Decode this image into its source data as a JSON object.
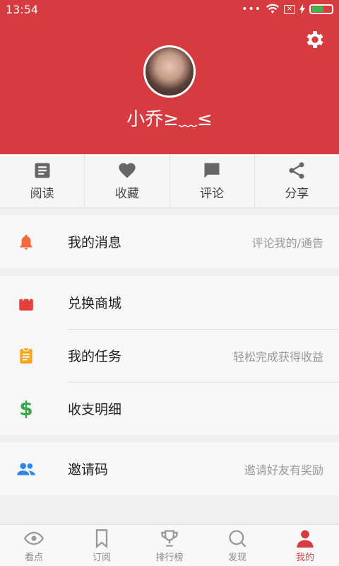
{
  "status": {
    "time": "13:54",
    "battery_level": 0.55
  },
  "profile": {
    "username": "小乔≥﹏≤"
  },
  "actions": [
    {
      "label": "阅读",
      "icon": "read-icon"
    },
    {
      "label": "收藏",
      "icon": "heart-icon"
    },
    {
      "label": "评论",
      "icon": "comment-icon"
    },
    {
      "label": "分享",
      "icon": "share-icon"
    }
  ],
  "menu": {
    "messages": {
      "label": "我的消息",
      "hint": "评论我的/通告",
      "icon": "bell-icon",
      "color": "#f4683a"
    },
    "store": {
      "label": "兑换商城",
      "icon": "shopping-bag-icon",
      "color": "#e63d3d"
    },
    "tasks": {
      "label": "我的任务",
      "hint": "轻松完成获得收益",
      "icon": "clipboard-icon",
      "color": "#f5a623"
    },
    "ledger": {
      "label": "收支明细",
      "icon": "dollar-icon",
      "color": "#3aa84a"
    },
    "invite": {
      "label": "邀请码",
      "hint": "邀请好友有奖励",
      "icon": "people-icon",
      "color": "#2f86e6"
    }
  },
  "tabs": [
    {
      "label": "看点",
      "icon": "eye-icon"
    },
    {
      "label": "订阅",
      "icon": "bookmark-icon"
    },
    {
      "label": "排行榜",
      "icon": "trophy-icon"
    },
    {
      "label": "发现",
      "icon": "search-icon"
    },
    {
      "label": "我的",
      "icon": "person-icon",
      "active": true
    }
  ],
  "colors": {
    "brand": "#d63c3f"
  }
}
